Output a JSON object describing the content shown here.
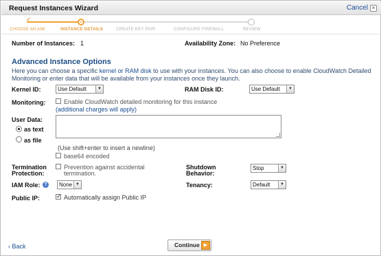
{
  "window": {
    "title": "Request Instances Wizard",
    "cancel_label": "Cancel",
    "close_glyph": "×"
  },
  "steps": [
    {
      "label": "CHOOSE AN AMI",
      "state": "done"
    },
    {
      "label": "INSTANCE DETAILS",
      "state": "current"
    },
    {
      "label": "CREATE KEY PAIR",
      "state": "todo"
    },
    {
      "label": "CONFIGURE FIREWALL",
      "state": "todo"
    },
    {
      "label": "REVIEW",
      "state": "todo"
    }
  ],
  "summary": {
    "instances_label": "Number of Instances:",
    "instances_value": "1",
    "zone_label": "Availability Zone:",
    "zone_value": "No Preference"
  },
  "advanced": {
    "title": "Advanced Instance Options",
    "desc_before": "Here you can choose a specific ",
    "desc_link": "kernel or RAM disk",
    "desc_after": " to use with your instances. You can also choose to enable CloudWatch Detailed Monitoring or enter data that will be available from your instances once they launch."
  },
  "kernel": {
    "label": "Kernel ID:",
    "value": "Use Default"
  },
  "ramdisk": {
    "label": "RAM Disk ID:",
    "value": "Use Default"
  },
  "monitoring": {
    "label": "Monitoring:",
    "checkbox_label": "Enable CloudWatch detailed monitoring for this instance",
    "note": "(additional charges will apply)",
    "checked": false
  },
  "user_data": {
    "label": "User Data:",
    "as_text": "as text",
    "as_file": "as file",
    "selected": "as text",
    "value": "",
    "hint": "(Use shift+enter to insert a newline)",
    "base64_label": "base64 encoded",
    "base64_checked": false
  },
  "termination": {
    "label_line1": "Termination",
    "label_line2": "Protection:",
    "checkbox_line1": "Prevention against accidental",
    "checkbox_line2": "termination.",
    "checked": false
  },
  "shutdown": {
    "label_line1": "Shutdown",
    "label_line2": "Behavior:",
    "value": "Stop"
  },
  "iam": {
    "label": "IAM Role:",
    "help_glyph": "?",
    "value": "None"
  },
  "tenancy": {
    "label": "Tenancy:",
    "value": "Default"
  },
  "public_ip": {
    "label": "Public IP:",
    "checkbox_label": "Automatically assign Public IP",
    "checked": true
  },
  "footer": {
    "back_label": "‹ Back",
    "continue_label": "Continue",
    "continue_glyph": "▶"
  },
  "colors": {
    "accent": "#f0a030",
    "section_title": "#1f4e86",
    "link": "#1a4d92"
  }
}
